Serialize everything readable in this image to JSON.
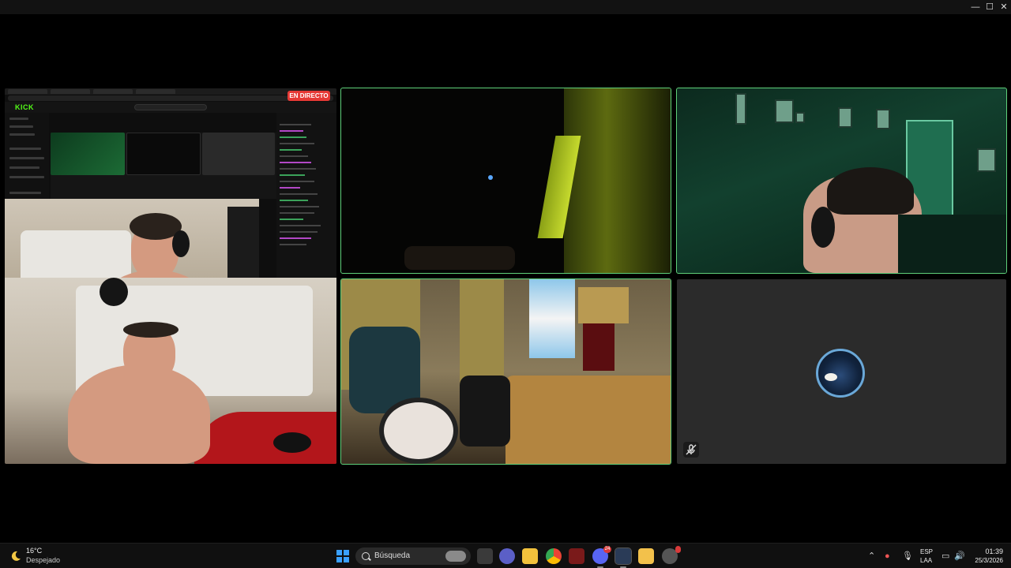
{
  "window": {
    "minimize_glyph": "—",
    "maximize_glyph": "☐",
    "close_glyph": "✕"
  },
  "stream": {
    "live_badge": "EN DIRECTO",
    "logo": "KICK"
  },
  "participants": [
    {
      "name": "stream-share",
      "speaking": false
    },
    {
      "name": "participant-2",
      "speaking": true
    },
    {
      "name": "participant-3",
      "speaking": true
    },
    {
      "name": "participant-4",
      "speaking": true
    },
    {
      "name": "participant-5",
      "camera_off": true,
      "muted": true
    }
  ],
  "taskbar": {
    "weather_temp": "16°C",
    "weather_desc": "Despejado",
    "search_placeholder": "Búsqueda",
    "apps": [
      {
        "icon": "file-explorer-icon"
      },
      {
        "icon": "teams-icon"
      },
      {
        "icon": "folder-icon"
      },
      {
        "icon": "chrome-icon"
      },
      {
        "icon": "app-red-icon"
      },
      {
        "icon": "discord-icon",
        "badge": "24"
      },
      {
        "icon": "steam-icon"
      },
      {
        "icon": "notes-icon"
      },
      {
        "icon": "dev-icon"
      }
    ],
    "lang_top": "ESP",
    "lang_bottom": "LAA",
    "time": "01:39",
    "date": "25/3/2026"
  },
  "colors": {
    "speaking_border": "#5fd07a",
    "kick_green": "#53fc18",
    "live_red": "#e53935",
    "taskbar_bg": "#101010"
  }
}
